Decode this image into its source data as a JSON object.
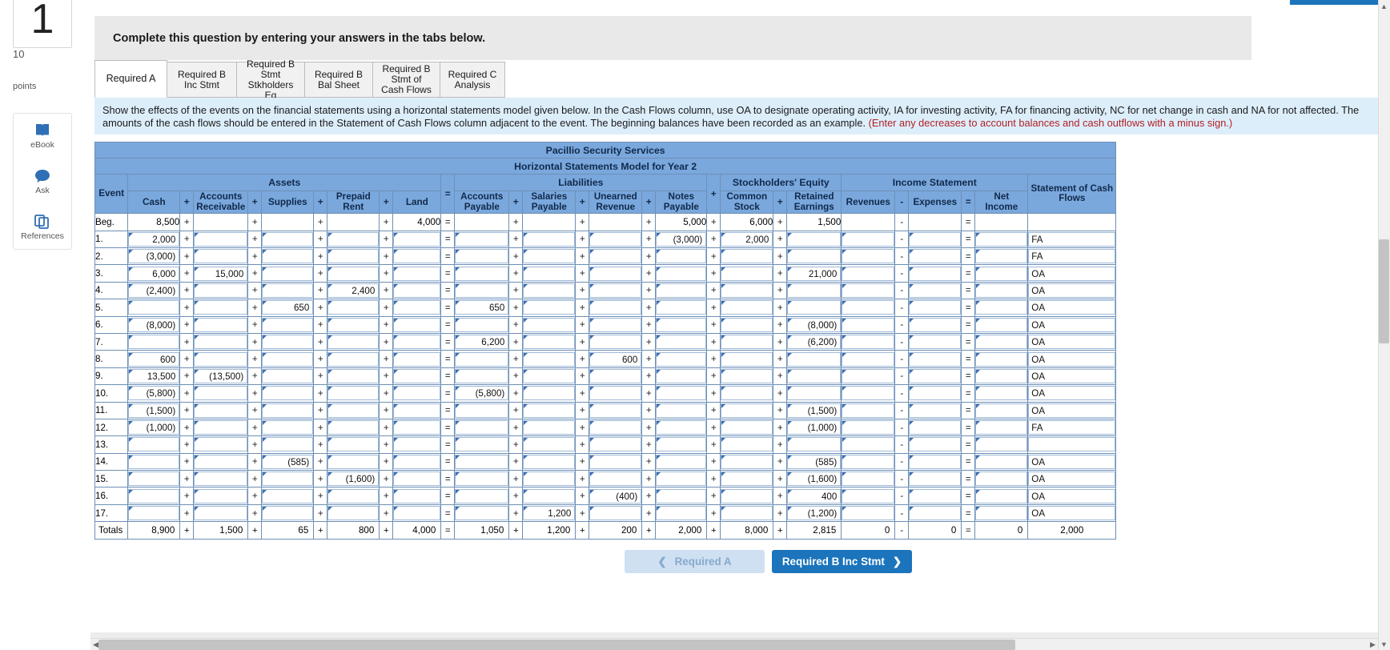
{
  "left_rail": {
    "question_number": "1",
    "points_value": "10",
    "points_label": "points",
    "tools": [
      {
        "name": "ebook",
        "label": "eBook",
        "icon": "book-icon"
      },
      {
        "name": "ask",
        "label": "Ask",
        "icon": "chat-icon"
      },
      {
        "name": "references",
        "label": "References",
        "icon": "copy-icon"
      }
    ]
  },
  "prompt_bar": {
    "text": "Complete this question by entering your answers in the tabs below."
  },
  "tabs": [
    {
      "label": "Required A",
      "active": true
    },
    {
      "label": "Required B Inc Stmt",
      "active": false
    },
    {
      "label": "Required B Stmt Stkholders Eq",
      "active": false
    },
    {
      "label": "Required B Bal Sheet",
      "active": false
    },
    {
      "label": "Required B Stmt of Cash Flows",
      "active": false
    },
    {
      "label": "Required C Analysis",
      "active": false
    }
  ],
  "instructions": {
    "part1": "Show the effects of the events on the financial statements using a horizontal statements model given below. In the Cash Flows column, use OA to designate operating activity, IA for investing activity, FA for financing activity, NC for net change in cash and NA for not affected. The amounts of the cash flows should be entered in the Statement of Cash Flows column adjacent to the",
    "part2": "event. The beginning balances have been recorded as an example.",
    "highlight": "(Enter any decreases to account balances and cash outflows with a minus sign.)"
  },
  "worksheet": {
    "company": "Pacillio Security Services",
    "subtitle": "Horizontal Statements Model for Year 2",
    "group_headers": {
      "event": "Event",
      "assets": "Assets",
      "eq_sign": "=",
      "liabilities": "Liabilities",
      "plus_sign": "+",
      "stockholders_equity": "Stockholders' Equity",
      "income_statement": "Income Statement",
      "cash_flows": "Statement of Cash Flows"
    },
    "columns": {
      "cash": "Cash",
      "accounts_receivable": "Accounts Receivable",
      "supplies": "Supplies",
      "prepaid_rent": "Prepaid Rent",
      "land": "Land",
      "accounts_payable": "Accounts Payable",
      "salaries_payable": "Salaries Payable",
      "unearned_revenue": "Unearned Revenue",
      "notes_payable": "Notes Payable",
      "common_stock": "Common Stock",
      "retained_earnings": "Retained Earnings",
      "revenues": "Revenues",
      "expenses": "Expenses",
      "net_income": "Net Income"
    },
    "operators": {
      "plus": "+",
      "equals": "=",
      "minus": "-"
    },
    "rows": [
      {
        "event": "Beg.",
        "editable": false,
        "cash": "8,500",
        "ar": "",
        "supplies": "",
        "prepaid": "",
        "land": "4,000",
        "ap": "",
        "sal": "",
        "unearned": "",
        "notes": "5,000",
        "cs": "6,000",
        "re": "1,500",
        "rev": "",
        "exp": "",
        "ni": "",
        "cf": ""
      },
      {
        "event": "1.",
        "editable": true,
        "cash": "2,000",
        "ar": "",
        "supplies": "",
        "prepaid": "",
        "land": "",
        "ap": "",
        "sal": "",
        "unearned": "",
        "notes": "(3,000)",
        "cs": "2,000",
        "re": "",
        "rev": "",
        "exp": "",
        "ni": "",
        "cf": "FA"
      },
      {
        "event": "2.",
        "editable": true,
        "cash": "(3,000)",
        "ar": "",
        "supplies": "",
        "prepaid": "",
        "land": "",
        "ap": "",
        "sal": "",
        "unearned": "",
        "notes": "",
        "cs": "",
        "re": "",
        "rev": "",
        "exp": "",
        "ni": "",
        "cf": "FA"
      },
      {
        "event": "3.",
        "editable": true,
        "cash": "6,000",
        "ar": "15,000",
        "supplies": "",
        "prepaid": "",
        "land": "",
        "ap": "",
        "sal": "",
        "unearned": "",
        "notes": "",
        "cs": "",
        "re": "21,000",
        "rev": "",
        "exp": "",
        "ni": "",
        "cf": "OA"
      },
      {
        "event": "4.",
        "editable": true,
        "cash": "(2,400)",
        "ar": "",
        "supplies": "",
        "prepaid": "2,400",
        "land": "",
        "ap": "",
        "sal": "",
        "unearned": "",
        "notes": "",
        "cs": "",
        "re": "",
        "rev": "",
        "exp": "",
        "ni": "",
        "cf": "OA"
      },
      {
        "event": "5.",
        "editable": true,
        "cash": "",
        "ar": "",
        "supplies": "650",
        "prepaid": "",
        "land": "",
        "ap": "650",
        "sal": "",
        "unearned": "",
        "notes": "",
        "cs": "",
        "re": "",
        "rev": "",
        "exp": "",
        "ni": "",
        "cf": "OA"
      },
      {
        "event": "6.",
        "editable": true,
        "cash": "(8,000)",
        "ar": "",
        "supplies": "",
        "prepaid": "",
        "land": "",
        "ap": "",
        "sal": "",
        "unearned": "",
        "notes": "",
        "cs": "",
        "re": "(8,000)",
        "rev": "",
        "exp": "",
        "ni": "",
        "cf": "OA"
      },
      {
        "event": "7.",
        "editable": true,
        "cash": "",
        "ar": "",
        "supplies": "",
        "prepaid": "",
        "land": "",
        "ap": "6,200",
        "sal": "",
        "unearned": "",
        "notes": "",
        "cs": "",
        "re": "(6,200)",
        "rev": "",
        "exp": "",
        "ni": "",
        "cf": "OA"
      },
      {
        "event": "8.",
        "editable": true,
        "cash": "600",
        "ar": "",
        "supplies": "",
        "prepaid": "",
        "land": "",
        "ap": "",
        "sal": "",
        "unearned": "600",
        "notes": "",
        "cs": "",
        "re": "",
        "rev": "",
        "exp": "",
        "ni": "",
        "cf": "OA"
      },
      {
        "event": "9.",
        "editable": true,
        "cash": "13,500",
        "ar": "(13,500)",
        "supplies": "",
        "prepaid": "",
        "land": "",
        "ap": "",
        "sal": "",
        "unearned": "",
        "notes": "",
        "cs": "",
        "re": "",
        "rev": "",
        "exp": "",
        "ni": "",
        "cf": "OA"
      },
      {
        "event": "10.",
        "editable": true,
        "cash": "(5,800)",
        "ar": "",
        "supplies": "",
        "prepaid": "",
        "land": "",
        "ap": "(5,800)",
        "sal": "",
        "unearned": "",
        "notes": "",
        "cs": "",
        "re": "",
        "rev": "",
        "exp": "",
        "ni": "",
        "cf": "OA"
      },
      {
        "event": "11.",
        "editable": true,
        "cash": "(1,500)",
        "ar": "",
        "supplies": "",
        "prepaid": "",
        "land": "",
        "ap": "",
        "sal": "",
        "unearned": "",
        "notes": "",
        "cs": "",
        "re": "(1,500)",
        "rev": "",
        "exp": "",
        "ni": "",
        "cf": "OA"
      },
      {
        "event": "12.",
        "editable": true,
        "cash": "(1,000)",
        "ar": "",
        "supplies": "",
        "prepaid": "",
        "land": "",
        "ap": "",
        "sal": "",
        "unearned": "",
        "notes": "",
        "cs": "",
        "re": "(1,000)",
        "rev": "",
        "exp": "",
        "ni": "",
        "cf": "FA"
      },
      {
        "event": "13.",
        "editable": true,
        "cash": "",
        "ar": "",
        "supplies": "",
        "prepaid": "",
        "land": "",
        "ap": "",
        "sal": "",
        "unearned": "",
        "notes": "",
        "cs": "",
        "re": "",
        "rev": "",
        "exp": "",
        "ni": "",
        "cf": ""
      },
      {
        "event": "14.",
        "editable": true,
        "cash": "",
        "ar": "",
        "supplies": "(585)",
        "prepaid": "",
        "land": "",
        "ap": "",
        "sal": "",
        "unearned": "",
        "notes": "",
        "cs": "",
        "re": "(585)",
        "rev": "",
        "exp": "",
        "ni": "",
        "cf": "OA"
      },
      {
        "event": "15.",
        "editable": true,
        "cash": "",
        "ar": "",
        "supplies": "",
        "prepaid": "(1,600)",
        "land": "",
        "ap": "",
        "sal": "",
        "unearned": "",
        "notes": "",
        "cs": "",
        "re": "(1,600)",
        "rev": "",
        "exp": "",
        "ni": "",
        "cf": "OA"
      },
      {
        "event": "16.",
        "editable": true,
        "cash": "",
        "ar": "",
        "supplies": "",
        "prepaid": "",
        "land": "",
        "ap": "",
        "sal": "",
        "unearned": "(400)",
        "notes": "",
        "cs": "",
        "re": "400",
        "rev": "",
        "exp": "",
        "ni": "",
        "cf": "OA"
      },
      {
        "event": "17.",
        "editable": true,
        "cash": "",
        "ar": "",
        "supplies": "",
        "prepaid": "",
        "land": "",
        "ap": "",
        "sal": "1,200",
        "unearned": "",
        "notes": "",
        "cs": "",
        "re": "(1,200)",
        "rev": "",
        "exp": "",
        "ni": "",
        "cf": "OA"
      }
    ],
    "totals": {
      "event": "Totals",
      "cash": "8,900",
      "ar": "1,500",
      "supplies": "65",
      "prepaid": "800",
      "land": "4,000",
      "ap": "1,050",
      "sal": "1,200",
      "unearned": "200",
      "notes": "2,000",
      "cs": "8,000",
      "re": "2,815",
      "rev": "0",
      "exp": "0",
      "ni": "0",
      "cf": "2,000"
    }
  },
  "nav": {
    "prev_label": "Required A",
    "next_label": "Required B Inc Stmt",
    "prev_icon": "chevron-left-icon",
    "next_icon": "chevron-right-icon"
  },
  "colors": {
    "header_blue": "#7aa8dd",
    "accent_blue": "#1b74bc",
    "instruction_bg": "#ddeefb",
    "highlight_red": "#b11f24"
  }
}
